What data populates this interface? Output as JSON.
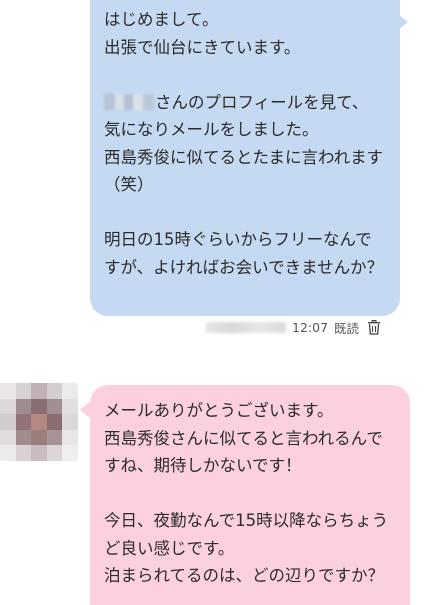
{
  "outgoing": {
    "line1": "はじめまして。\n出張で仙台にきています。\n\n",
    "name_suffix": "さんのプロフィールを見て、",
    "line2": "\n気になりメールをしました。\n西島秀俊に似てるとたまに言われます（笑）\n\n明日の15時ぐらいからフリーなんですが、よければお会いできませんか？",
    "time": "12:07",
    "status": "既読",
    "delete_icon": "trash-icon"
  },
  "incoming": {
    "text": "メールありがとうございます。\n西島秀俊さんに似てると言われるんですね、期待しかないです！\n\n今日、夜勤なんで15時以降ならちょうど良い感じです。\n泊まられてるのは、どの辺りですか？"
  },
  "colors": {
    "outgoing_bubble": "#c6d9f2",
    "incoming_bubble": "#fcd0de"
  }
}
